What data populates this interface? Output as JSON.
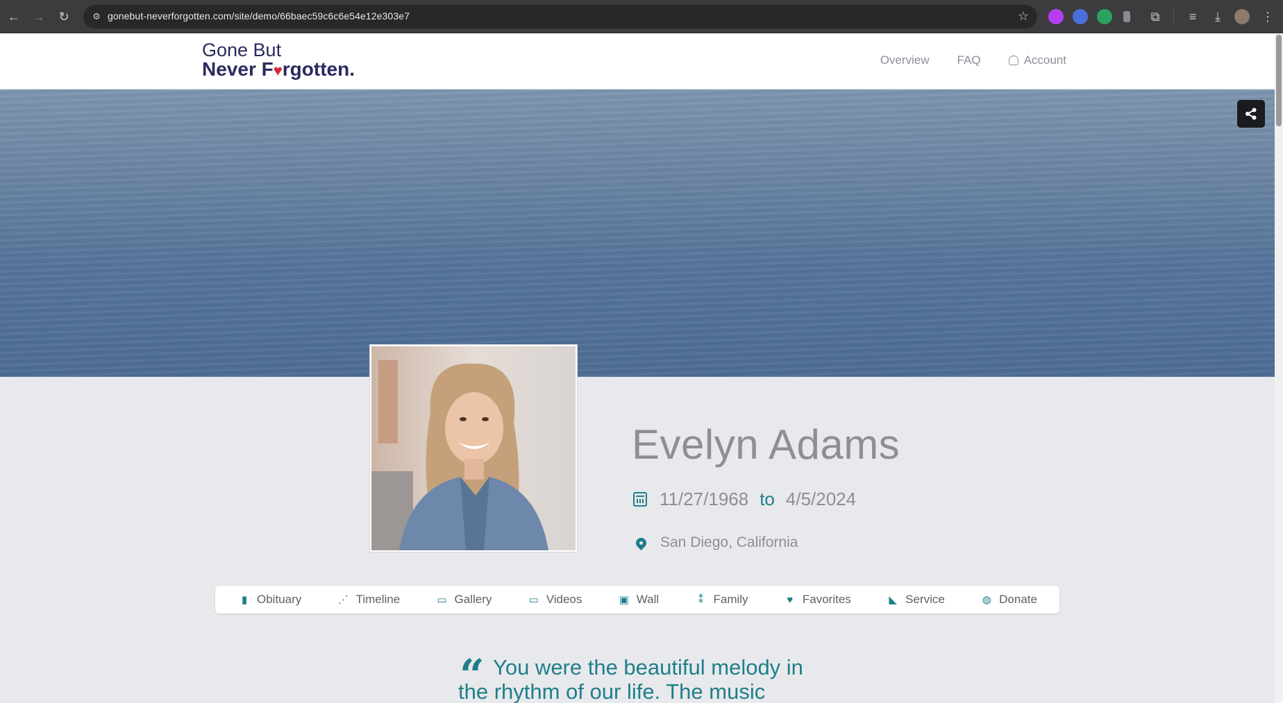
{
  "browser": {
    "url": "gonebut-neverforgotten.com/site/demo/66baec59c6c6e54e12e303e7"
  },
  "site": {
    "logo_line1": "Gone But",
    "logo_line2_a": "Never F",
    "logo_heart": "♥",
    "logo_line2_b": "rgotten.",
    "nav": {
      "overview": "Overview",
      "faq": "FAQ",
      "account": "Account"
    }
  },
  "profile": {
    "name": "Evelyn Adams",
    "birth_date": "11/27/1968",
    "to_label": "to",
    "death_date": "4/5/2024",
    "location": "San Diego, California"
  },
  "tabs": [
    {
      "label": "Obituary",
      "icon": "book-icon",
      "glyph": "▮"
    },
    {
      "label": "Timeline",
      "icon": "timeline-icon",
      "glyph": "⋰"
    },
    {
      "label": "Gallery",
      "icon": "gallery-icon",
      "glyph": "▭"
    },
    {
      "label": "Videos",
      "icon": "video-camera-icon",
      "glyph": "▭"
    },
    {
      "label": "Wall",
      "icon": "wall-icon",
      "glyph": "▣"
    },
    {
      "label": "Family",
      "icon": "family-icon",
      "glyph": "⁑"
    },
    {
      "label": "Favorites",
      "icon": "heart-icon",
      "glyph": "♥"
    },
    {
      "label": "Service",
      "icon": "service-icon",
      "glyph": "◣"
    },
    {
      "label": "Donate",
      "icon": "donate-icon",
      "glyph": "◍"
    }
  ],
  "quote": {
    "text": "You were the beautiful melody in the rhythm of our life. The music"
  },
  "colors": {
    "accent": "#1e7f8a",
    "logo": "#2b2a5e",
    "heart": "#d72638"
  }
}
